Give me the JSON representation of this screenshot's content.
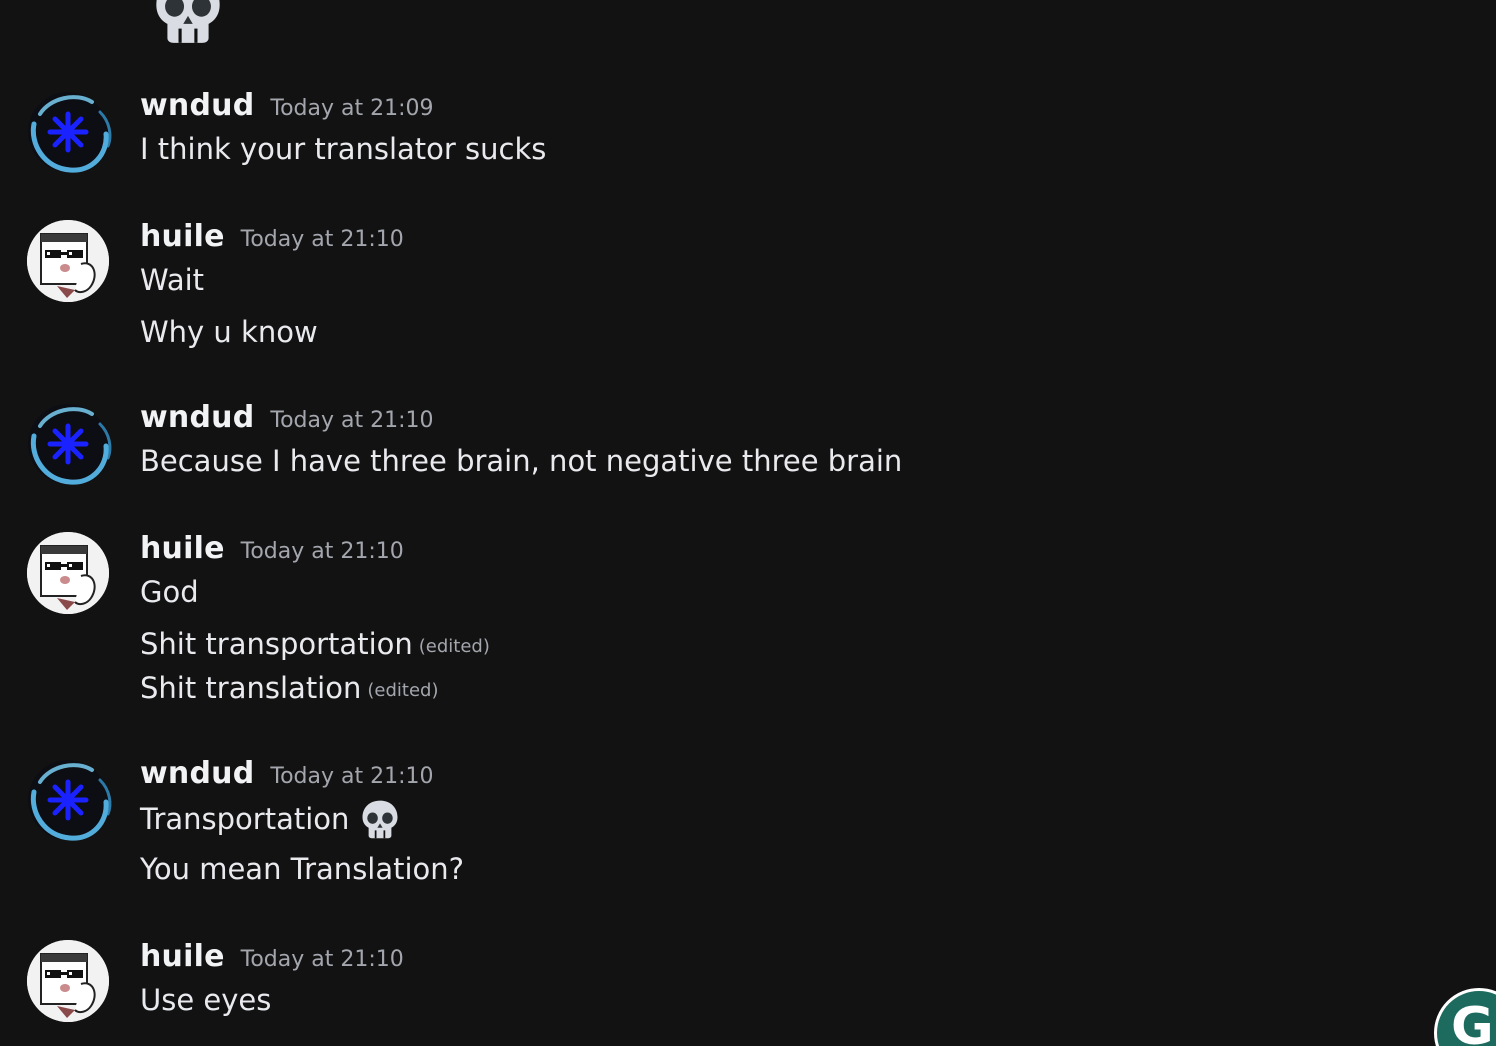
{
  "colors": {
    "background": "#121213",
    "username": "#f2f3f5",
    "timestamp": "#a3a6ad",
    "message_text": "#e9eaee",
    "grammarly_badge": "#1d6b5e"
  },
  "icons": {
    "top_emoji": "skull-emoji",
    "inline_emoji": "skull-emoji",
    "floating_badge": "grammarly-g-icon"
  },
  "messages": [
    {
      "username": "wndud",
      "timestamp": "Today at 21:09",
      "lines": [
        {
          "text": "I think your translator sucks"
        }
      ]
    },
    {
      "username": "huile",
      "timestamp": "Today at 21:10",
      "lines": [
        {
          "text": "Wait"
        },
        {
          "text": "Why u know"
        }
      ]
    },
    {
      "username": "wndud",
      "timestamp": "Today at 21:10",
      "lines": [
        {
          "text": "Because I have three brain, not negative three brain"
        }
      ]
    },
    {
      "username": "huile",
      "timestamp": "Today at 21:10",
      "lines": [
        {
          "text": "God"
        },
        {
          "text": "Shit transportation",
          "edited": "(edited)"
        },
        {
          "text": "Shit translation",
          "edited": "(edited)"
        }
      ]
    },
    {
      "username": "wndud",
      "timestamp": "Today at 21:10",
      "lines": [
        {
          "text": "Transportation"
        },
        {
          "text": "You mean Translation?"
        }
      ]
    },
    {
      "username": "huile",
      "timestamp": "Today at 21:10",
      "lines": [
        {
          "text": "Use eyes"
        }
      ]
    }
  ],
  "grammarly_badge": {
    "letter": "G"
  }
}
